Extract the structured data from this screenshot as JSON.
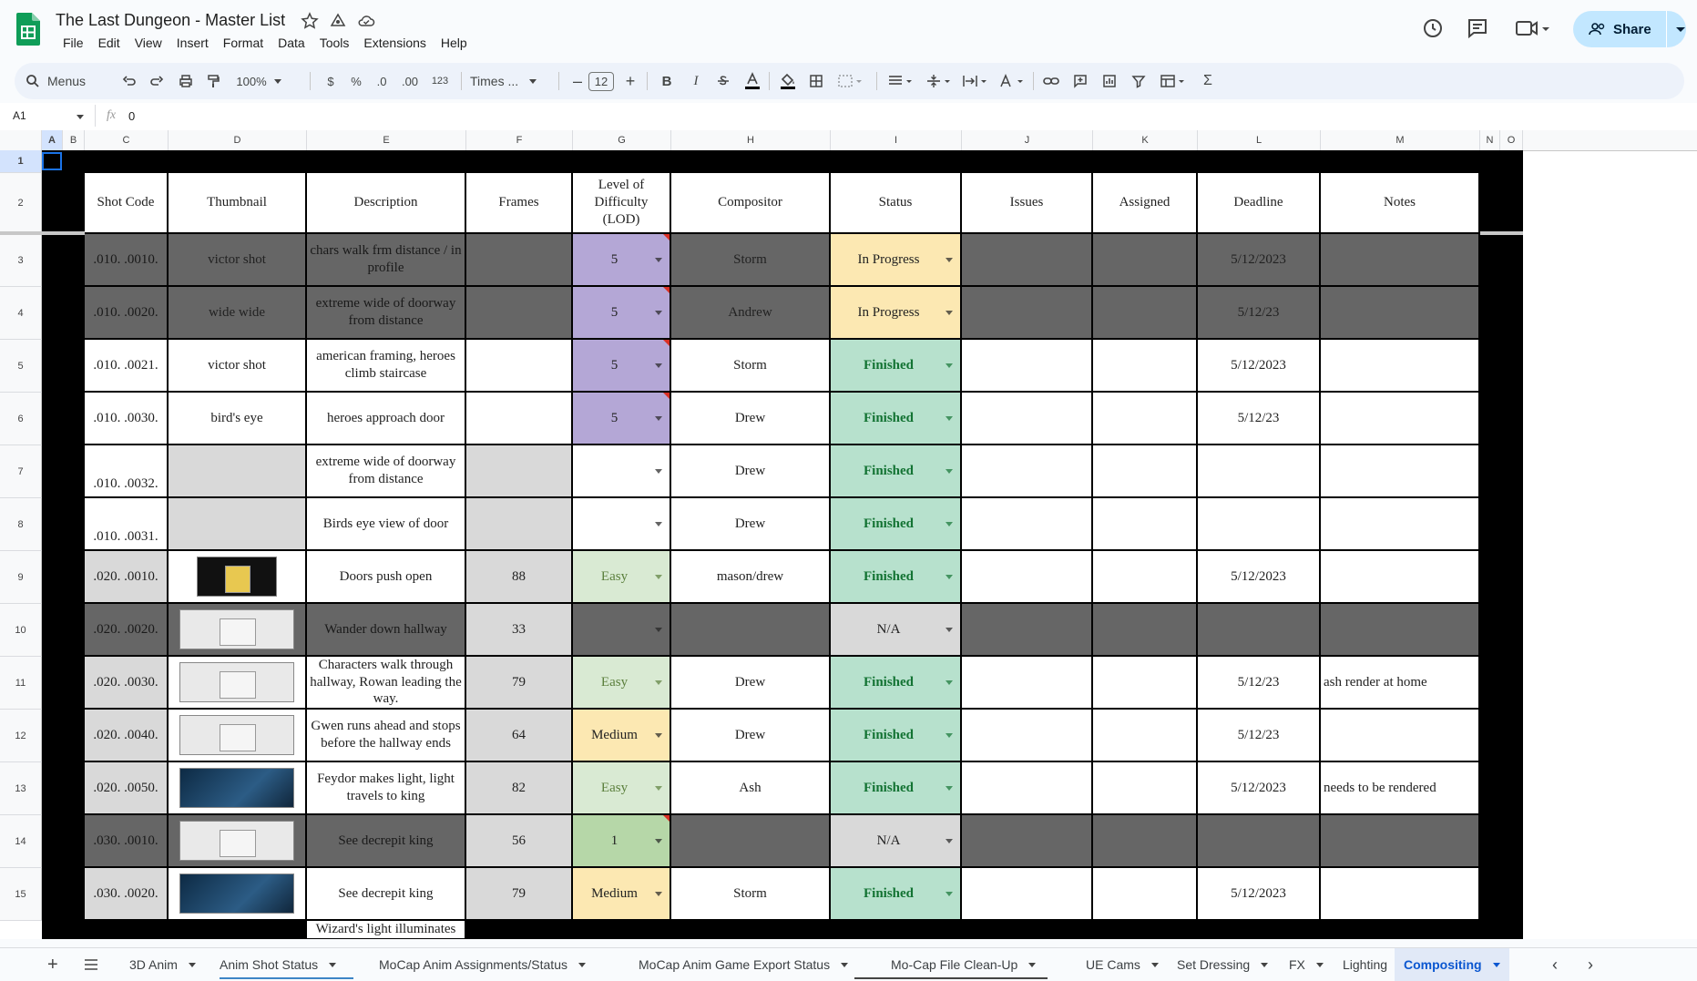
{
  "app": {
    "title": "The Last Dungeon - Master List",
    "menus": [
      "File",
      "Edit",
      "View",
      "Insert",
      "Format",
      "Data",
      "Tools",
      "Extensions",
      "Help"
    ],
    "share_label": "Share"
  },
  "toolbar": {
    "search_label": "Menus",
    "zoom": "100%",
    "currency": "$",
    "percent": "%",
    "dec_decrease": ".0",
    "dec_increase": ".00",
    "number_format": "123",
    "font": "Times ...",
    "font_size": "12",
    "bold": "B",
    "italic": "I"
  },
  "formula_bar": {
    "cell_ref": "A1",
    "fx": "fx",
    "value": "0"
  },
  "columns": [
    "A",
    "B",
    "C",
    "D",
    "E",
    "F",
    "G",
    "H",
    "I",
    "J",
    "K",
    "L",
    "M",
    "N",
    "O"
  ],
  "rows": [
    "1",
    "2",
    "3",
    "4",
    "5",
    "6",
    "7",
    "8",
    "9",
    "10",
    "11",
    "12",
    "13",
    "14",
    "15"
  ],
  "headers": {
    "shot_code": "Shot Code",
    "thumbnail": "Thumbnail",
    "description": "Description",
    "frames": "Frames",
    "lod": "Level of Difficulty (LOD)",
    "compositor": "Compositor",
    "status": "Status",
    "issues": "Issues",
    "assigned": "Assigned",
    "deadline": "Deadline",
    "notes": "Notes"
  },
  "table": [
    {
      "shot": ".010. .0010.",
      "thumb": "victor shot",
      "desc": "chars walk frm distance / in profile",
      "frames": "",
      "lod": "5",
      "comp": "Storm",
      "status": "In Progress",
      "deadline": "5/12/2023",
      "notes": ""
    },
    {
      "shot": ".010. .0020.",
      "thumb": "wide wide",
      "desc": "extreme wide of doorway from distance",
      "frames": "",
      "lod": "5",
      "comp": "Andrew",
      "status": "In Progress",
      "deadline": "5/12/23",
      "notes": ""
    },
    {
      "shot": ".010. .0021.",
      "thumb": "victor shot",
      "desc": "american framing, heroes climb staircase",
      "frames": "",
      "lod": "5",
      "comp": "Storm",
      "status": "Finished",
      "deadline": "5/12/2023",
      "notes": ""
    },
    {
      "shot": ".010. .0030.",
      "thumb": "bird's eye",
      "desc": "heroes approach door",
      "frames": "",
      "lod": "5",
      "comp": "Drew",
      "status": "Finished",
      "deadline": "5/12/23",
      "notes": ""
    },
    {
      "shot": ".010. .0032.",
      "thumb": "",
      "desc": "extreme wide of doorway from distance",
      "frames": "",
      "lod": "",
      "comp": "Drew",
      "status": "Finished",
      "deadline": "",
      "notes": ""
    },
    {
      "shot": ".010. .0031.",
      "thumb": "",
      "desc": "Birds eye view of door",
      "frames": "",
      "lod": "",
      "comp": "Drew",
      "status": "Finished",
      "deadline": "",
      "notes": ""
    },
    {
      "shot": ".020. .0010.",
      "thumb": "",
      "desc": "Doors push open",
      "frames": "88",
      "lod": "Easy",
      "comp": "mason/drew",
      "status": "Finished",
      "deadline": "5/12/2023",
      "notes": ""
    },
    {
      "shot": ".020. .0020.",
      "thumb": "",
      "desc": "Wander down hallway",
      "frames": "33",
      "lod": "",
      "comp": "",
      "status": "N/A",
      "deadline": "",
      "notes": ""
    },
    {
      "shot": ".020. .0030.",
      "thumb": "",
      "desc": "Characters walk through hallway, Rowan leading the way.",
      "frames": "79",
      "lod": "Easy",
      "comp": "Drew",
      "status": "Finished",
      "deadline": "5/12/23",
      "notes": "ash render at home"
    },
    {
      "shot": ".020. .0040.",
      "thumb": "",
      "desc": "Gwen runs ahead and stops before the hallway ends",
      "frames": "64",
      "lod": "Medium",
      "comp": "Drew",
      "status": "Finished",
      "deadline": "5/12/23",
      "notes": ""
    },
    {
      "shot": ".020. .0050.",
      "thumb": "",
      "desc": "Feydor makes light, light travels to king",
      "frames": "82",
      "lod": "Easy",
      "comp": "Ash",
      "status": "Finished",
      "deadline": "5/12/2023",
      "notes": "needs to be rendered"
    },
    {
      "shot": ".030. .0010.",
      "thumb": "",
      "desc": "See decrepit king",
      "frames": "56",
      "lod": "1",
      "comp": "",
      "status": "N/A",
      "deadline": "",
      "notes": ""
    },
    {
      "shot": ".030. .0020.",
      "thumb": "",
      "desc": "See decrepit king",
      "frames": "79",
      "lod": "Medium",
      "comp": "Storm",
      "status": "Finished",
      "deadline": "5/12/2023",
      "notes": ""
    },
    {
      "shot": "",
      "thumb": "",
      "desc": "Wizard's light illuminates",
      "frames": "",
      "lod": "",
      "comp": "",
      "status": "",
      "deadline": "",
      "notes": ""
    }
  ],
  "tabs": [
    "3D Anim",
    "Anim Shot Status",
    "MoCap Anim Assignments/Status",
    "MoCap Anim Game Export Status",
    "Mo-Cap File Clean-Up",
    "UE Cams",
    "Set Dressing",
    "FX",
    "Lighting",
    "Compositing"
  ],
  "active_tab": "Compositing",
  "colors": {
    "lod_purple": "#b4a7d6",
    "in_progress": "#fce8b2",
    "finished": "#b7e1cd",
    "easy": "#d9ead3",
    "medium": "#fce8b2",
    "lod_1": "#b6d7a8",
    "dark_row": "#666666",
    "grey_cell": "#d9d9d9",
    "share": "#c2e7ff"
  }
}
